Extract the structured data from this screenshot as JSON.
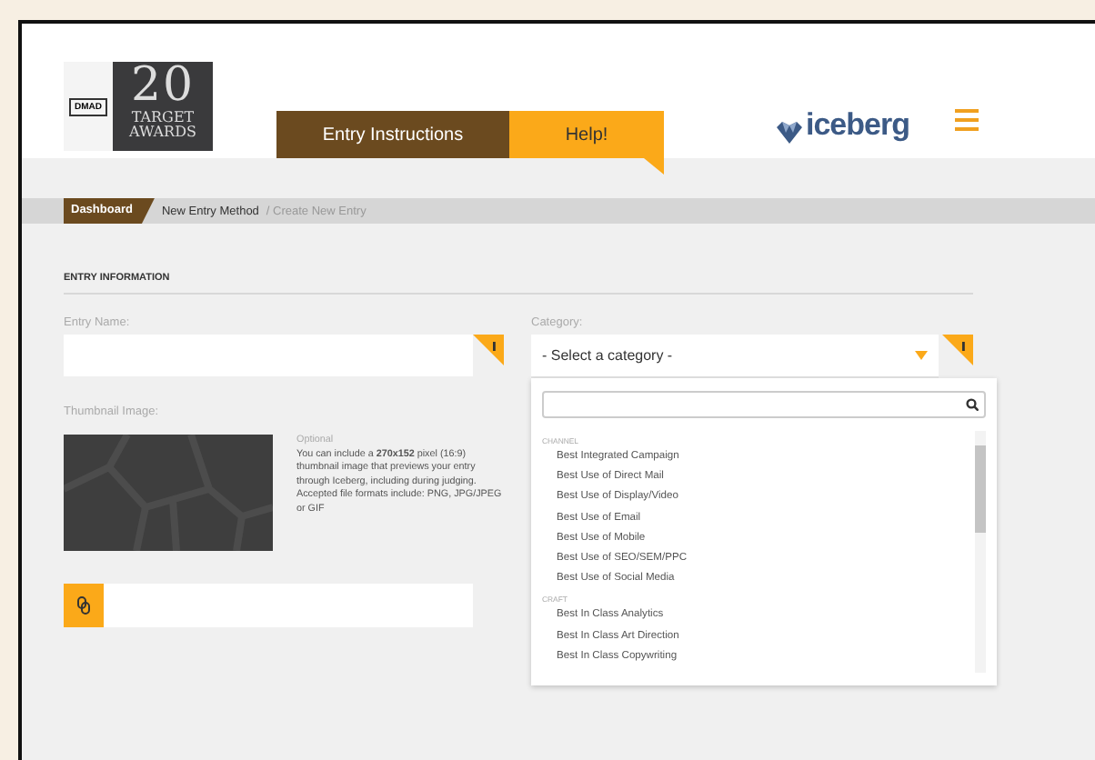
{
  "logo": {
    "badge": "DMAD",
    "number": "20",
    "lines": [
      "TARGET",
      "AWARDS"
    ]
  },
  "tabs": [
    {
      "label": "Entry Instructions",
      "selected": false
    },
    {
      "label": "Help!",
      "selected": true
    }
  ],
  "brand": {
    "name": "iceberg"
  },
  "breadcrumb": [
    {
      "label": "Dashboard",
      "kind": "home"
    },
    {
      "label": "New Entry Method",
      "kind": "link"
    },
    {
      "label": "/ Create New Entry",
      "kind": "current"
    }
  ],
  "section_title": "ENTRY INFORMATION",
  "entry_name": {
    "label": "Entry Name:"
  },
  "category": {
    "label": "Category:",
    "placeholder": "- Select a category -",
    "expanded": true
  },
  "dropdown": {
    "groups": [
      {
        "label": "CHANNEL",
        "options": [
          "Best Integrated Campaign",
          "Best Use of Direct Mail",
          "Best Use of Display/Video",
          "Best Use of Email",
          "Best Use of Mobile",
          "Best Use of SEO/SEM/PPC",
          "Best Use of Social Media"
        ]
      },
      {
        "label": "CRAFT",
        "options": [
          "Best In Class Analytics",
          "Best In Class Art Direction",
          "Best In Class Copywriting"
        ]
      }
    ]
  },
  "thumbnail": {
    "label": "Thumbnail Image:",
    "note": "Optional",
    "help": "You can include a **270x152** pixel (16:9) thumbnail image that previews your entry through Iceberg, including during judging.",
    "formats": "Accepted file formats include: PNG, JPG/JPEG or GIF"
  }
}
